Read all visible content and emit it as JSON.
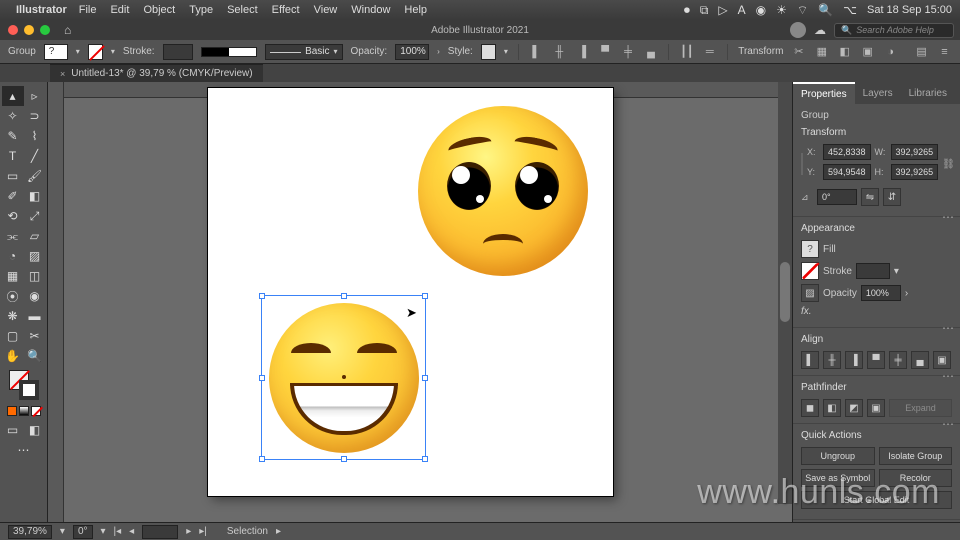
{
  "menubar": {
    "app": "Illustrator",
    "items": [
      "File",
      "Edit",
      "Object",
      "Type",
      "Select",
      "Effect",
      "View",
      "Window",
      "Help"
    ],
    "datetime": "Sat 18 Sep  15:00"
  },
  "titlebar": {
    "title": "Adobe Illustrator 2021",
    "search_placeholder": "Search Adobe Help"
  },
  "ctrlbar": {
    "selection": "Group",
    "stroke_label": "Stroke:",
    "stroke_profile": "Basic",
    "opacity_label": "Opacity:",
    "opacity_value": "100%",
    "style_label": "Style:",
    "transform_label": "Transform"
  },
  "tab": {
    "label": "Untitled-13* @ 39,79 % (CMYK/Preview)"
  },
  "properties": {
    "tabs": [
      "Properties",
      "Layers",
      "Libraries"
    ],
    "selection_type": "Group",
    "transform": {
      "heading": "Transform",
      "x": "452,8338",
      "y": "594,9548",
      "w": "392,9265",
      "h": "392,9265",
      "angle": "0°"
    },
    "appearance": {
      "heading": "Appearance",
      "fill_label": "Fill",
      "stroke_label": "Stroke",
      "opacity_label": "Opacity",
      "opacity_value": "100%",
      "fx_label": "fx."
    },
    "align": {
      "heading": "Align"
    },
    "pathfinder": {
      "heading": "Pathfinder",
      "expand": "Expand"
    },
    "quick": {
      "heading": "Quick Actions",
      "ungroup": "Ungroup",
      "isolate": "Isolate Group",
      "symbol": "Save as Symbol",
      "recolor": "Recolor",
      "global": "Start Global Edit"
    }
  },
  "status": {
    "zoom": "39,79%",
    "rotate": "0°",
    "tool": "Selection"
  },
  "watermark": "www.hunls.com"
}
